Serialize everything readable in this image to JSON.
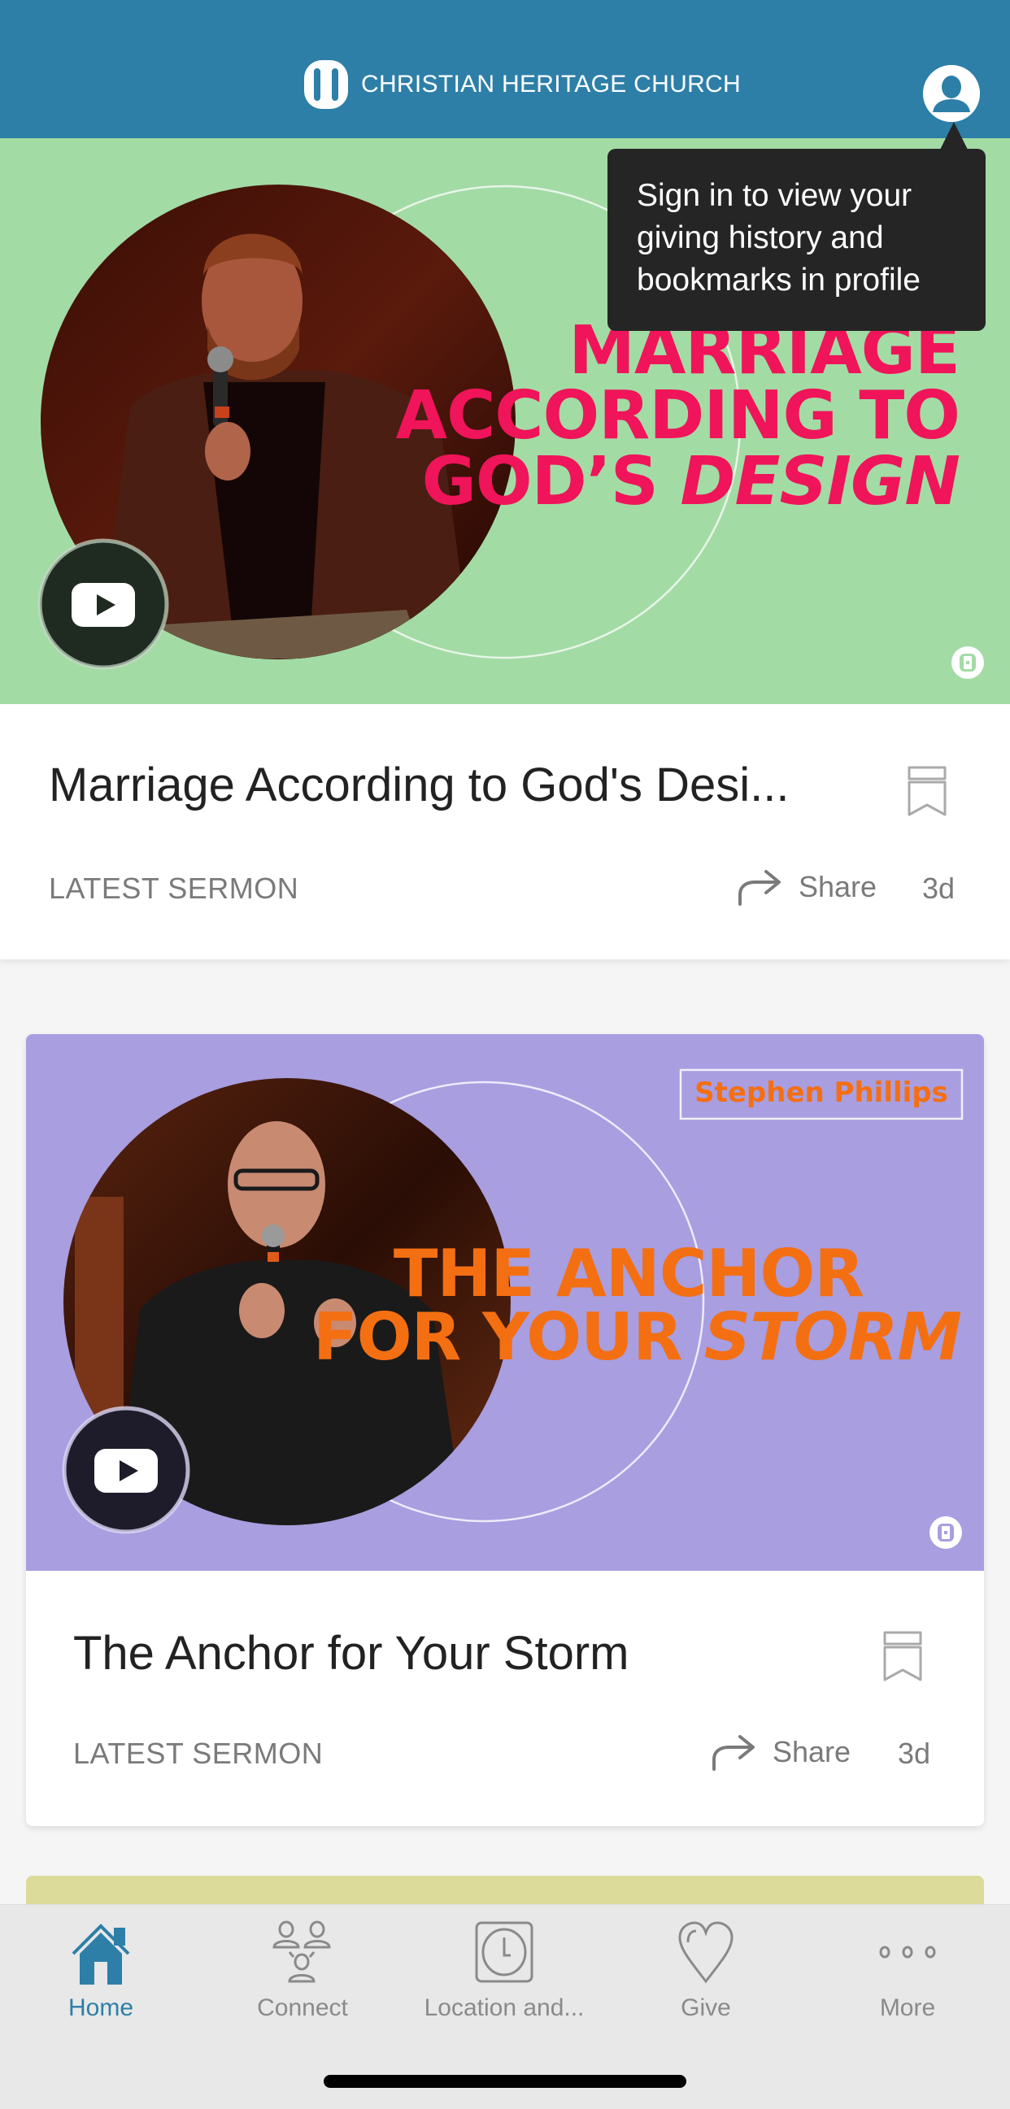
{
  "app": {
    "name": "CHRISTIAN HERITAGE CHURCH",
    "brand_color": "#2d7fa8",
    "profile_icon": "person-circle-icon"
  },
  "tooltip": {
    "text": "Sign in to view your giving history and bookmarks in profile"
  },
  "feed": [
    {
      "banner": {
        "background": "#a3dba5",
        "accent": "#f0145a",
        "title_lines": [
          "MARRIAGE",
          "ACCORDING TO",
          "GOD’S "
        ],
        "title_emphasis": "DESIGN",
        "speaker": "",
        "play_icon": "youtube-play-icon"
      },
      "title": "Marriage According to God's Desi...",
      "category": "LATEST SERMON",
      "share_label": "Share",
      "age": "3d",
      "bookmarked": false
    },
    {
      "banner": {
        "background": "#a89ee0",
        "accent": "#f46f12",
        "title_lines": [
          "THE ANCHOR",
          "FOR YOUR "
        ],
        "title_emphasis": "STORM",
        "speaker": "Stephen Phillips",
        "play_icon": "youtube-play-icon"
      },
      "title": "The Anchor for Your Storm",
      "category": "LATEST SERMON",
      "share_label": "Share",
      "age": "3d",
      "bookmarked": false
    },
    {
      "banner": {
        "background": "#dcdb9a"
      }
    }
  ],
  "tabs": [
    {
      "label": "Home",
      "icon": "home-icon",
      "active": true
    },
    {
      "label": "Connect",
      "icon": "people-icon",
      "active": false
    },
    {
      "label": "Location and...",
      "icon": "clock-icon",
      "active": false
    },
    {
      "label": "Give",
      "icon": "heart-icon",
      "active": false
    },
    {
      "label": "More",
      "icon": "more-dots-icon",
      "active": false
    }
  ],
  "colors": {
    "tab_active": "#2d7fa8",
    "tab_inactive": "#8a8a8a",
    "tooltip_bg": "#252525"
  }
}
